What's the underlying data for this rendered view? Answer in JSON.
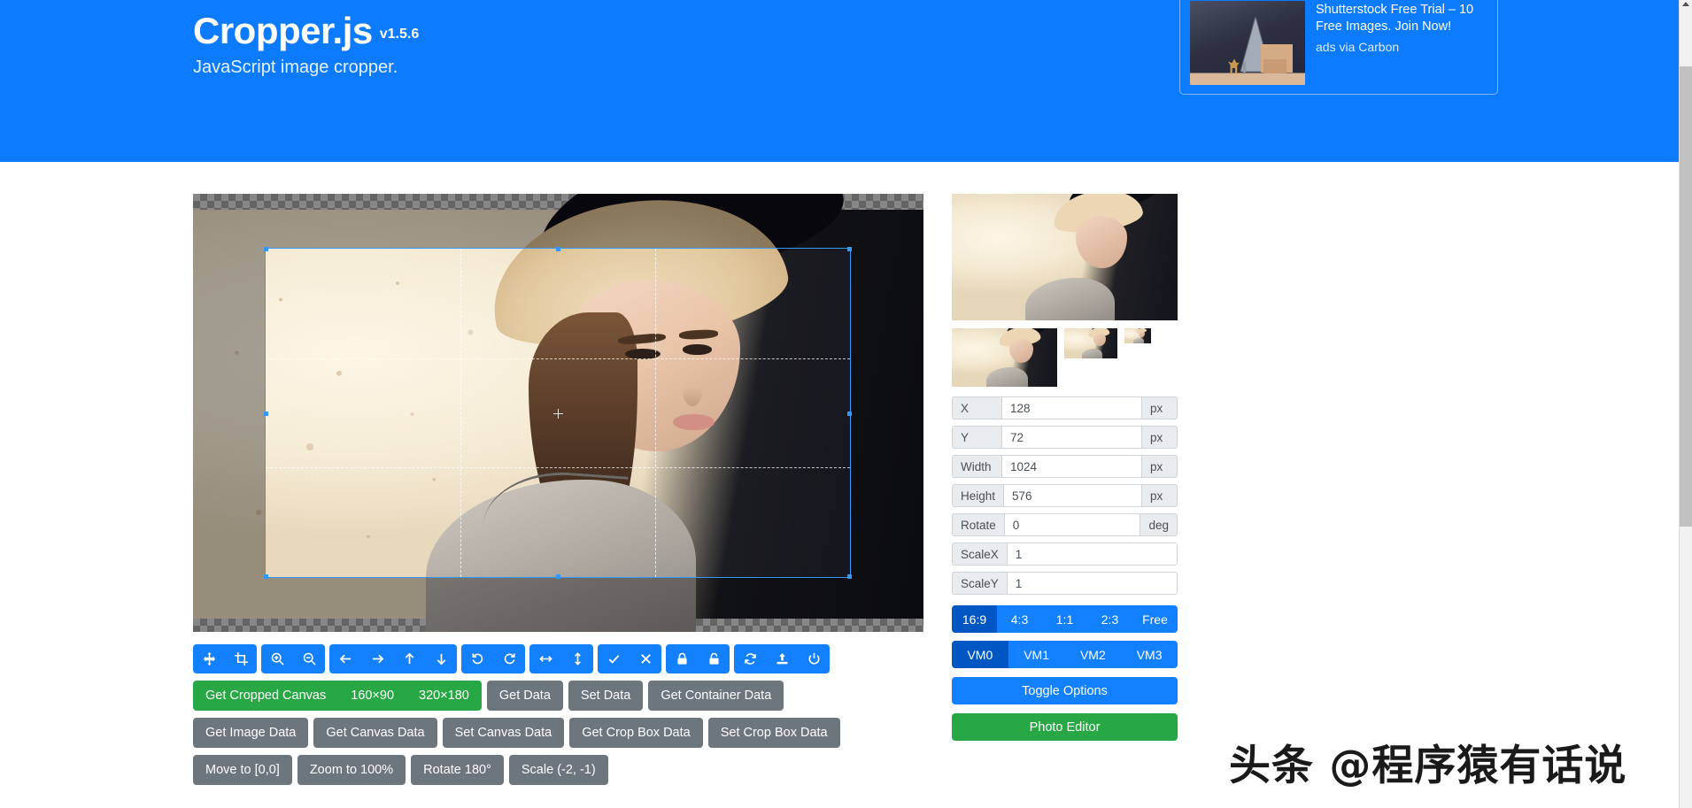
{
  "header": {
    "title": "Cropper.js",
    "version": "v1.5.6",
    "subtitle": "JavaScript image cropper.",
    "brand_color": "#0d7bff"
  },
  "ad": {
    "line1": "Shutterstock Free Trial – 10",
    "line2": "Free Images. Join Now!",
    "powered_by": "ads via Carbon",
    "image_alt": "holiday-tree-gifts-photo"
  },
  "toolbar": {
    "groups": [
      {
        "buttons": [
          {
            "name": "move-icon",
            "title": "Move"
          },
          {
            "name": "crop-icon",
            "title": "Crop"
          }
        ]
      },
      {
        "buttons": [
          {
            "name": "zoom-in-icon",
            "title": "Zoom In"
          },
          {
            "name": "zoom-out-icon",
            "title": "Zoom Out"
          }
        ]
      },
      {
        "buttons": [
          {
            "name": "arrow-left-icon",
            "title": "Move Left"
          },
          {
            "name": "arrow-right-icon",
            "title": "Move Right"
          },
          {
            "name": "arrow-up-icon",
            "title": "Move Up"
          },
          {
            "name": "arrow-down-icon",
            "title": "Move Down"
          }
        ]
      },
      {
        "buttons": [
          {
            "name": "rotate-left-icon",
            "title": "Rotate Left"
          },
          {
            "name": "rotate-right-icon",
            "title": "Rotate Right"
          }
        ]
      },
      {
        "buttons": [
          {
            "name": "flip-horizontal-icon",
            "title": "Flip Horizontal"
          },
          {
            "name": "flip-vertical-icon",
            "title": "Flip Vertical"
          }
        ]
      },
      {
        "buttons": [
          {
            "name": "check-icon",
            "title": "Enable"
          },
          {
            "name": "close-icon",
            "title": "Disable"
          }
        ]
      },
      {
        "buttons": [
          {
            "name": "lock-icon",
            "title": "Lock"
          },
          {
            "name": "unlock-icon",
            "title": "Unlock"
          }
        ]
      },
      {
        "buttons": [
          {
            "name": "reset-icon",
            "title": "Reset"
          },
          {
            "name": "upload-icon",
            "title": "Upload"
          },
          {
            "name": "power-icon",
            "title": "Destroy"
          }
        ]
      }
    ]
  },
  "actions": {
    "cropped_canvas_group": [
      {
        "label": "Get Cropped Canvas",
        "name": "get-cropped-canvas-button"
      },
      {
        "label": "160×90",
        "name": "cropped-canvas-160x90-button"
      },
      {
        "label": "320×180",
        "name": "cropped-canvas-320x180-button"
      }
    ],
    "row1_secondary": [
      {
        "label": "Get Data",
        "name": "get-data-button"
      },
      {
        "label": "Set Data",
        "name": "set-data-button"
      },
      {
        "label": "Get Container Data",
        "name": "get-container-data-button"
      }
    ],
    "row2": [
      {
        "label": "Get Image Data",
        "name": "get-image-data-button"
      },
      {
        "label": "Get Canvas Data",
        "name": "get-canvas-data-button"
      },
      {
        "label": "Set Canvas Data",
        "name": "set-canvas-data-button"
      },
      {
        "label": "Get Crop Box Data",
        "name": "get-crop-box-data-button"
      },
      {
        "label": "Set Crop Box Data",
        "name": "set-crop-box-data-button"
      }
    ],
    "row3": [
      {
        "label": "Move to [0,0]",
        "name": "move-to-origin-button"
      },
      {
        "label": "Zoom to 100%",
        "name": "zoom-to-100-button"
      },
      {
        "label": "Rotate 180°",
        "name": "rotate-180-button"
      },
      {
        "label": "Scale (-2, -1)",
        "name": "scale-neg2-neg1-button"
      }
    ]
  },
  "sidebar": {
    "fields": [
      {
        "label": "X",
        "value": "128",
        "unit": "px"
      },
      {
        "label": "Y",
        "value": "72",
        "unit": "px"
      },
      {
        "label": "Width",
        "value": "1024",
        "unit": "px"
      },
      {
        "label": "Height",
        "value": "576",
        "unit": "px"
      },
      {
        "label": "Rotate",
        "value": "0",
        "unit": "deg"
      },
      {
        "label": "ScaleX",
        "value": "1",
        "unit": ""
      },
      {
        "label": "ScaleY",
        "value": "1",
        "unit": ""
      }
    ],
    "aspect_ratios": [
      {
        "label": "16:9",
        "active": true
      },
      {
        "label": "4:3",
        "active": false
      },
      {
        "label": "1:1",
        "active": false
      },
      {
        "label": "2:3",
        "active": false
      },
      {
        "label": "Free",
        "active": false
      }
    ],
    "view_modes": [
      {
        "label": "VM0",
        "active": true
      },
      {
        "label": "VM1",
        "active": false
      },
      {
        "label": "VM2",
        "active": false
      },
      {
        "label": "VM3",
        "active": false
      }
    ],
    "toggle_options_label": "Toggle Options",
    "photo_editor_label": "Photo Editor",
    "accent_color": "#1280ff",
    "active_color": "#0057c4",
    "success_color": "#28a745"
  },
  "watermark": {
    "text": "头条 @程序猿有话说"
  }
}
